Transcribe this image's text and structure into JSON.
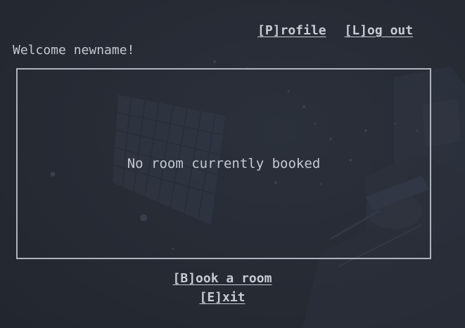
{
  "nav": {
    "profile_label": "[P]rofile",
    "logout_label": "[L]og out"
  },
  "welcome": {
    "text": "Welcome newname!"
  },
  "booking": {
    "status": "No room currently booked"
  },
  "actions": {
    "book_label": "[B]ook a room",
    "exit_label": "[E]xit"
  },
  "colors": {
    "background": "#272b35",
    "text": "#c5c9d1",
    "border": "#aeb3bd"
  }
}
